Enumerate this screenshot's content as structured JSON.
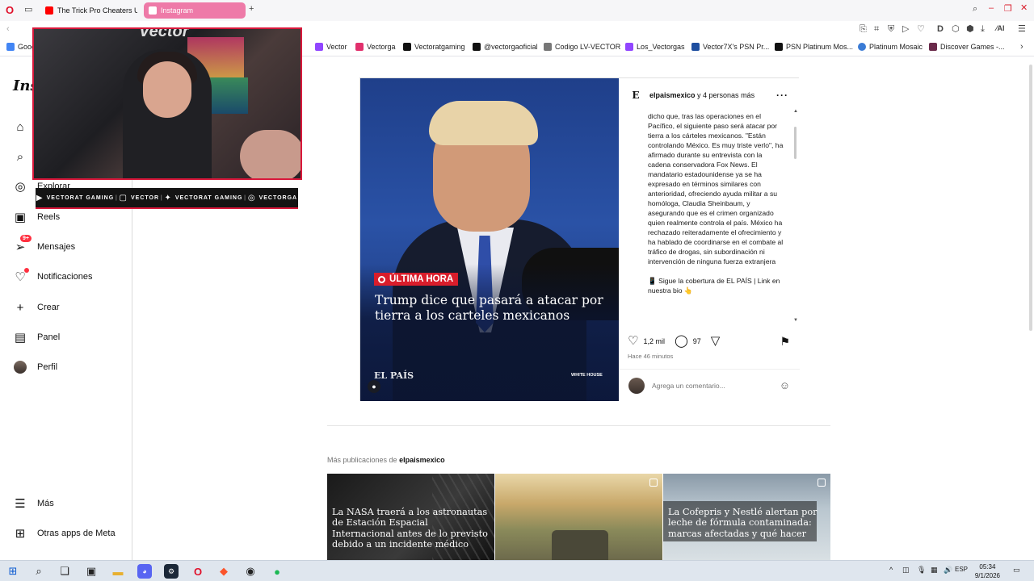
{
  "browser": {
    "tabs": [
      {
        "label": "The Trick Pro Cheaters Us",
        "icon": "youtube-icon",
        "color": "#ff0000"
      },
      {
        "label": "Instagram",
        "icon": "instagram-icon",
        "color": "#e1306c",
        "active": true
      }
    ],
    "bookmarks": [
      {
        "label": "Goog",
        "icon": "google-icon"
      },
      {
        "label": "Vector",
        "icon": "twitch-icon"
      },
      {
        "label": "Vectorga",
        "icon": "instagram-icon"
      },
      {
        "label": "Vectoratgaming",
        "icon": "x-icon"
      },
      {
        "label": "@vectorgaoficial",
        "icon": "tiktok-icon"
      },
      {
        "label": "Codigo LV-VECTOR",
        "icon": "tag-icon"
      },
      {
        "label": "Los_Vectorgas",
        "icon": "twitch-icon"
      },
      {
        "label": "Vector7X's PSN Pr...",
        "icon": "psn-icon"
      },
      {
        "label": "PSN Platinum Mos...",
        "icon": "psn-icon"
      },
      {
        "label": "Platinum Mosaic",
        "icon": "globe-icon"
      },
      {
        "label": "Discover Games -...",
        "icon": "game-icon"
      }
    ]
  },
  "sidebar": {
    "logo": "Ins",
    "items": [
      {
        "label": "",
        "icon": "home-icon"
      },
      {
        "label": "",
        "icon": "search-icon"
      },
      {
        "label": "Explorar",
        "icon": "compass-icon"
      },
      {
        "label": "Reels",
        "icon": "reels-icon"
      },
      {
        "label": "Mensajes",
        "icon": "messages-icon",
        "badge": "9+"
      },
      {
        "label": "Notificaciones",
        "icon": "heart-icon"
      },
      {
        "label": "Crear",
        "icon": "plus-icon"
      },
      {
        "label": "Panel",
        "icon": "chart-icon"
      },
      {
        "label": "Perfil",
        "icon": "avatar"
      }
    ],
    "more": "Más",
    "meta_apps": "Otras apps de Meta"
  },
  "overlay": {
    "watermark": "Vector",
    "social": [
      "VECTORAT GAMING",
      "VECTOR",
      "VECTORAT GAMING",
      "VECTORGA"
    ]
  },
  "post": {
    "account": "elpaismexico",
    "account_suffix": " y 4 personas más",
    "image": {
      "badge": "ÚLTIMA HORA",
      "headline": "Trump dice que pasará a atacar por tierra a los carteles mexicanos",
      "brand": "EL PAÍS",
      "credit": "WHITE HOUSE"
    },
    "caption": "dicho que, tras las operaciones en el Pacífico, el siguiente paso será atacar por tierra a los cárteles mexicanos. \"Están controlando México. Es muy triste verlo\", ha afirmado durante su entrevista con la cadena conservadora Fox News. El mandatario estadounidense ya se ha expresado en términos similares con anterioridad, ofreciendo ayuda militar a su homóloga, Claudia Sheinbaum, y asegurando que es el crimen organizado quien realmente controla el país. México ha rechazado reiteradamente el ofrecimiento y ha hablado de coordinarse en el combate al tráfico de drogas, sin subordinación ni intervención de ninguna fuerza extranjera",
    "caption_link": "📱 Sigue la cobertura de EL PAÍS | Link en nuestra bio 👆",
    "likes": "1,2 mil",
    "comments": "97",
    "time": "Hace 46 minutos",
    "comment_placeholder": "Agrega un comentario..."
  },
  "more_posts": {
    "title_prefix": "Más publicaciones de ",
    "account": "elpaismexico",
    "items": [
      {
        "headline": "La NASA traerá a los astronautas de Estación Espacial Internacional antes de lo previsto debido a un incidente médico"
      },
      {
        "headline": ""
      },
      {
        "headline": "La Cofepris y Nestlé alertan por leche de fórmula contaminada: marcas afectadas y qué hacer"
      }
    ]
  },
  "taskbar": {
    "language": "ESP",
    "time": "05:34",
    "date": "9/1/2026"
  }
}
